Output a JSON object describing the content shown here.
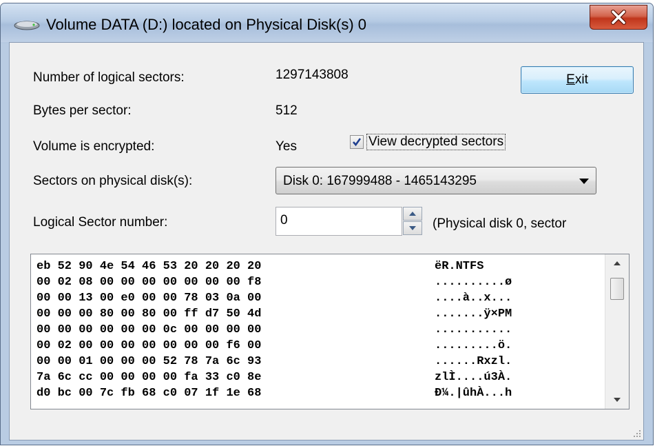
{
  "window": {
    "title": "Volume DATA (D:) located on Physical Disk(s) 0"
  },
  "fields": {
    "logical_sectors_label": "Number of logical sectors:",
    "logical_sectors_value": "1297143808",
    "bytes_per_sector_label": "Bytes per sector:",
    "bytes_per_sector_value": "512",
    "encrypted_label": "Volume is encrypted:",
    "encrypted_value": "Yes",
    "sectors_on_disk_label": "Sectors on physical disk(s):",
    "logical_sector_label": "Logical Sector number:"
  },
  "exit_button": {
    "accel": "E",
    "rest": "xit"
  },
  "view_decrypted": {
    "label": "View decrypted sectors",
    "checked": true
  },
  "disk_select": {
    "selected": "Disk 0: 167999488 - 1465143295"
  },
  "sector_input": {
    "value": "0"
  },
  "physical_info": "(Physical disk 0, sector",
  "hex_dump": {
    "hex": [
      "eb 52 90 4e 54 46 53 20 20 20 20",
      "00 02 08 00 00 00 00 00 00 00 f8",
      "00 00 13 00 e0 00 00 78 03 0a 00",
      "00 00 00 80 00 80 00 ff d7 50 4d",
      "00 00 00 00 00 00 0c 00 00 00 00",
      "00 02 00 00 00 00 00 00 00 f6 00",
      "00 00 01 00 00 00 52 78 7a 6c 93",
      "7a 6c cc 00 00 00 00 fa 33 c0 8e",
      "d0 bc 00 7c fb 68 c0 07 1f 1e 68"
    ],
    "ascii": [
      "ëR.NTFS",
      "..........ø",
      "....à..x...",
      ".......ÿ×PM",
      "...........",
      ".........ö.",
      "......Rxzl.",
      "zlÌ....ú3À.",
      "Ð¼.|ûhÀ...h"
    ]
  },
  "colors": {
    "accent": "#3c7fb1",
    "close": "#c0361c"
  }
}
